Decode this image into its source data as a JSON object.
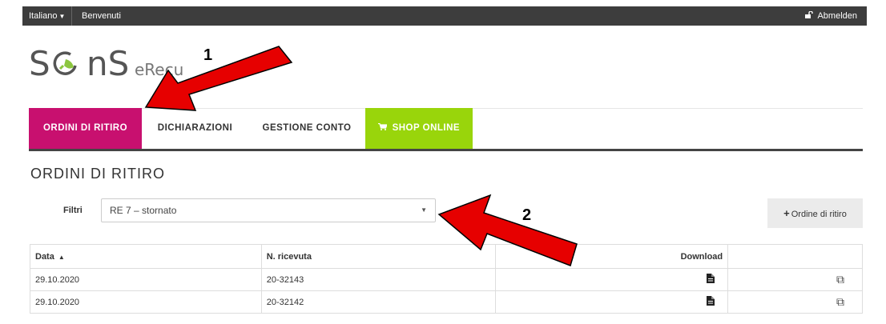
{
  "topbar": {
    "language": "Italiano",
    "welcome": "Benvenuti",
    "logout": "Abmelden"
  },
  "logo": {
    "brand": "SENS",
    "sub": "eRecu"
  },
  "nav": {
    "tabs": [
      {
        "label": "ORDINI DI RITIRO",
        "active": true
      },
      {
        "label": "DICHIARAZIONI",
        "active": false
      },
      {
        "label": "GESTIONE CONTO",
        "active": false
      },
      {
        "label": "SHOP ONLINE",
        "active": false
      }
    ]
  },
  "page": {
    "title": "ORDINI DI RITIRO",
    "filter_label": "Filtri",
    "filter_value": "RE 7 – stornato",
    "add_button": "Ordine di ritiro"
  },
  "table": {
    "headers": [
      "Data",
      "N. ricevuta",
      "",
      "Download",
      ""
    ],
    "rows": [
      {
        "date": "29.10.2020",
        "receipt": "20-32143"
      },
      {
        "date": "29.10.2020",
        "receipt": "20-32142"
      }
    ]
  },
  "annotations": {
    "arrow1": "1",
    "arrow2": "2"
  },
  "colors": {
    "active_tab": "#c8106f",
    "shop_tab": "#99d50b",
    "topbar": "#3d3d3d",
    "arrow": "#e60000"
  },
  "icons": {
    "language_caret": "caret-down-icon",
    "logout": "unlock-icon",
    "shop": "cart-icon",
    "sort": "sort-asc-icon",
    "download": "file-icon",
    "copy": "copy-icon"
  }
}
